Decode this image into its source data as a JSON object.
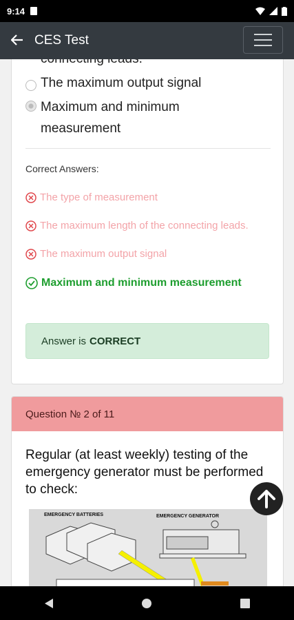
{
  "status": {
    "time": "9:14"
  },
  "header": {
    "title": "CES Test"
  },
  "q1": {
    "partial_option": "connecting leads.",
    "options": [
      "The maximum output signal",
      "Maximum and minimum measurement"
    ],
    "correct_label": "Correct Answers:",
    "answers_wrong": [
      "The type of measurement",
      "The maximum length of the connecting leads.",
      "The maximum output signal"
    ],
    "answer_right": "Maximum and minimum measurement",
    "result_prefix": "Answer is",
    "result_value": "CORRECT"
  },
  "q2": {
    "header": "Question № 2 of 11",
    "text": "Regular (at least weekly) testing of the emergency generator must be performed to check:",
    "image_labels": [
      "EMERGENCY BATTERIES",
      "EMERGENCY GENERATOR"
    ]
  },
  "colors": {
    "app_bar": "#343a40",
    "correct": "#1e9e2f",
    "wrong": "#f3a3a8",
    "q_header": "#f09b9d",
    "result_bg": "#d4edda"
  }
}
